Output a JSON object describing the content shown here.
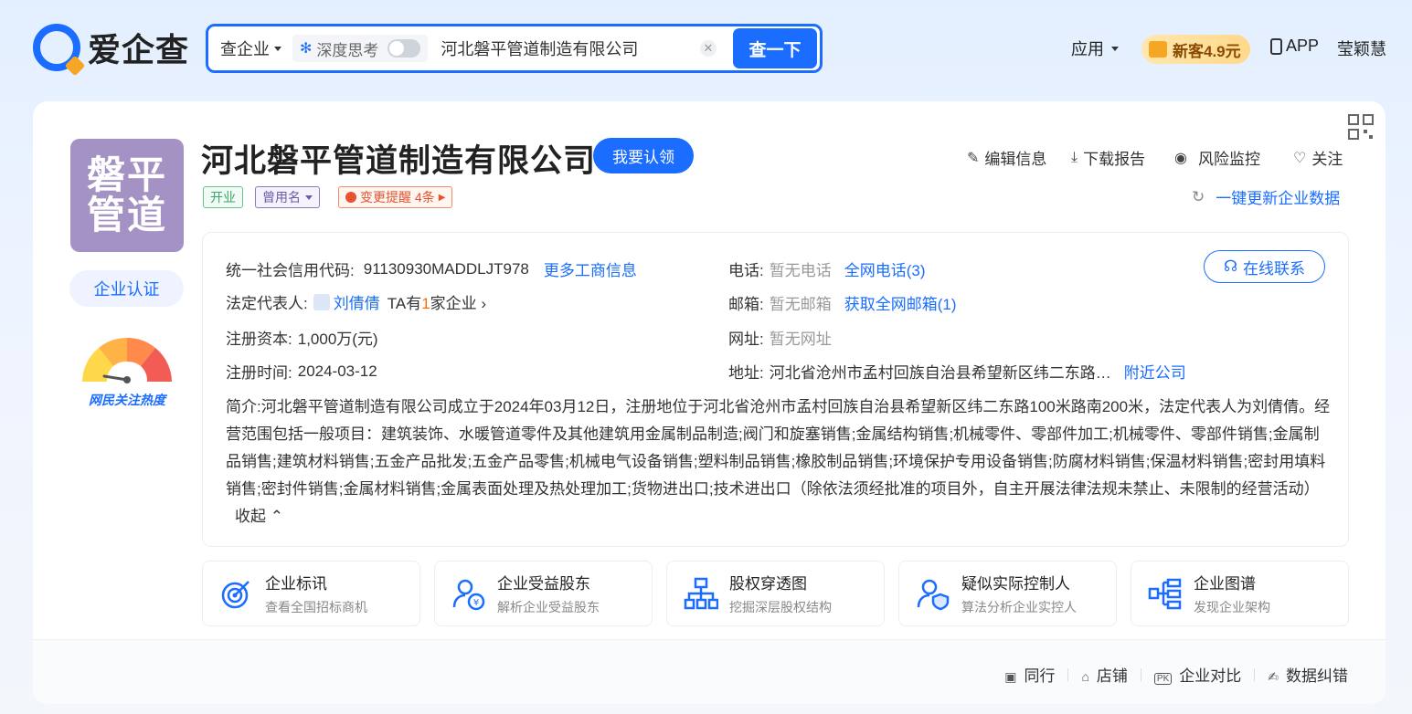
{
  "header": {
    "logo_text": "爱企查",
    "search_type": "查企业",
    "deep_think_label": "深度思考",
    "search_value": "河北磐平管道制造有限公司",
    "search_button": "查一下",
    "nav_app": "应用",
    "vip_label": "新客4.9元",
    "app_label": "APP",
    "user_name": "莹颖慧"
  },
  "company": {
    "avatar_text": "磐平管道",
    "name": "河北磐平管道制造有限公司",
    "claim_button": "我要认领",
    "cert_button": "企业认证",
    "heat_label": "网民关注热度",
    "tags": {
      "status": "开业",
      "alias": "曾用名",
      "change": "变更提醒 4条"
    },
    "actions": {
      "edit": "编辑信息",
      "download": "下载报告",
      "monitor": "风险监控",
      "follow": "关注",
      "refresh": "一键更新企业数据"
    }
  },
  "info": {
    "credit_code_label": "统一社会信用代码:",
    "credit_code": "91130930MADDLJT978",
    "more_info": "更多工商信息",
    "legal_rep_label": "法定代表人:",
    "legal_rep": "刘倩倩",
    "legal_rep_companies_prefix": "TA有",
    "legal_rep_companies_count": "1",
    "legal_rep_companies_suffix": "家企业",
    "capital_label": "注册资本:",
    "capital": "1,000万(元)",
    "reg_date_label": "注册时间:",
    "reg_date": "2024-03-12",
    "phone_label": "电话:",
    "phone": "暂无电话",
    "phone_link": "全网电话(3)",
    "email_label": "邮箱:",
    "email": "暂无邮箱",
    "email_link": "获取全网邮箱(1)",
    "website_label": "网址:",
    "website": "暂无网址",
    "address_label": "地址:",
    "address": "河北省沧州市孟村回族自治县希望新区纬二东路…",
    "nearby_link": "附近公司",
    "online_contact": "在线联系",
    "intro_label": "简介:",
    "intro": "河北磐平管道制造有限公司成立于2024年03月12日，注册地位于河北省沧州市孟村回族自治县希望新区纬二东路100米路南200米，法定代表人为刘倩倩。经营范围包括一般项目：建筑装饰、水暖管道零件及其他建筑用金属制品制造;阀门和旋塞销售;金属结构销售;机械零件、零部件加工;机械零件、零部件销售;金属制品销售;建筑材料销售;五金产品批发;五金产品零售;机械电气设备销售;塑料制品销售;橡胶制品销售;环境保护专用设备销售;防腐材料销售;保温材料销售;密封用填料销售;密封件销售;金属材料销售;金属表面处理及热处理加工;货物进出口;技术进出口（除依法须经批准的项目外，自主开展法律法规未禁止、未限制的经营活动）",
    "collapse": "收起"
  },
  "tiles": [
    {
      "title": "企业标讯",
      "sub": "查看全国招标商机"
    },
    {
      "title": "企业受益股东",
      "sub": "解析企业受益股东"
    },
    {
      "title": "股权穿透图",
      "sub": "挖掘深层股权结构"
    },
    {
      "title": "疑似实际控制人",
      "sub": "算法分析企业实控人"
    },
    {
      "title": "企业图谱",
      "sub": "发现企业架构"
    }
  ],
  "footer": {
    "peers": "同行",
    "shops": "店铺",
    "compare": "企业对比",
    "correction": "数据纠错"
  },
  "colors": {
    "brand": "#1a6dff",
    "avatar_bg": "#a592c4"
  }
}
